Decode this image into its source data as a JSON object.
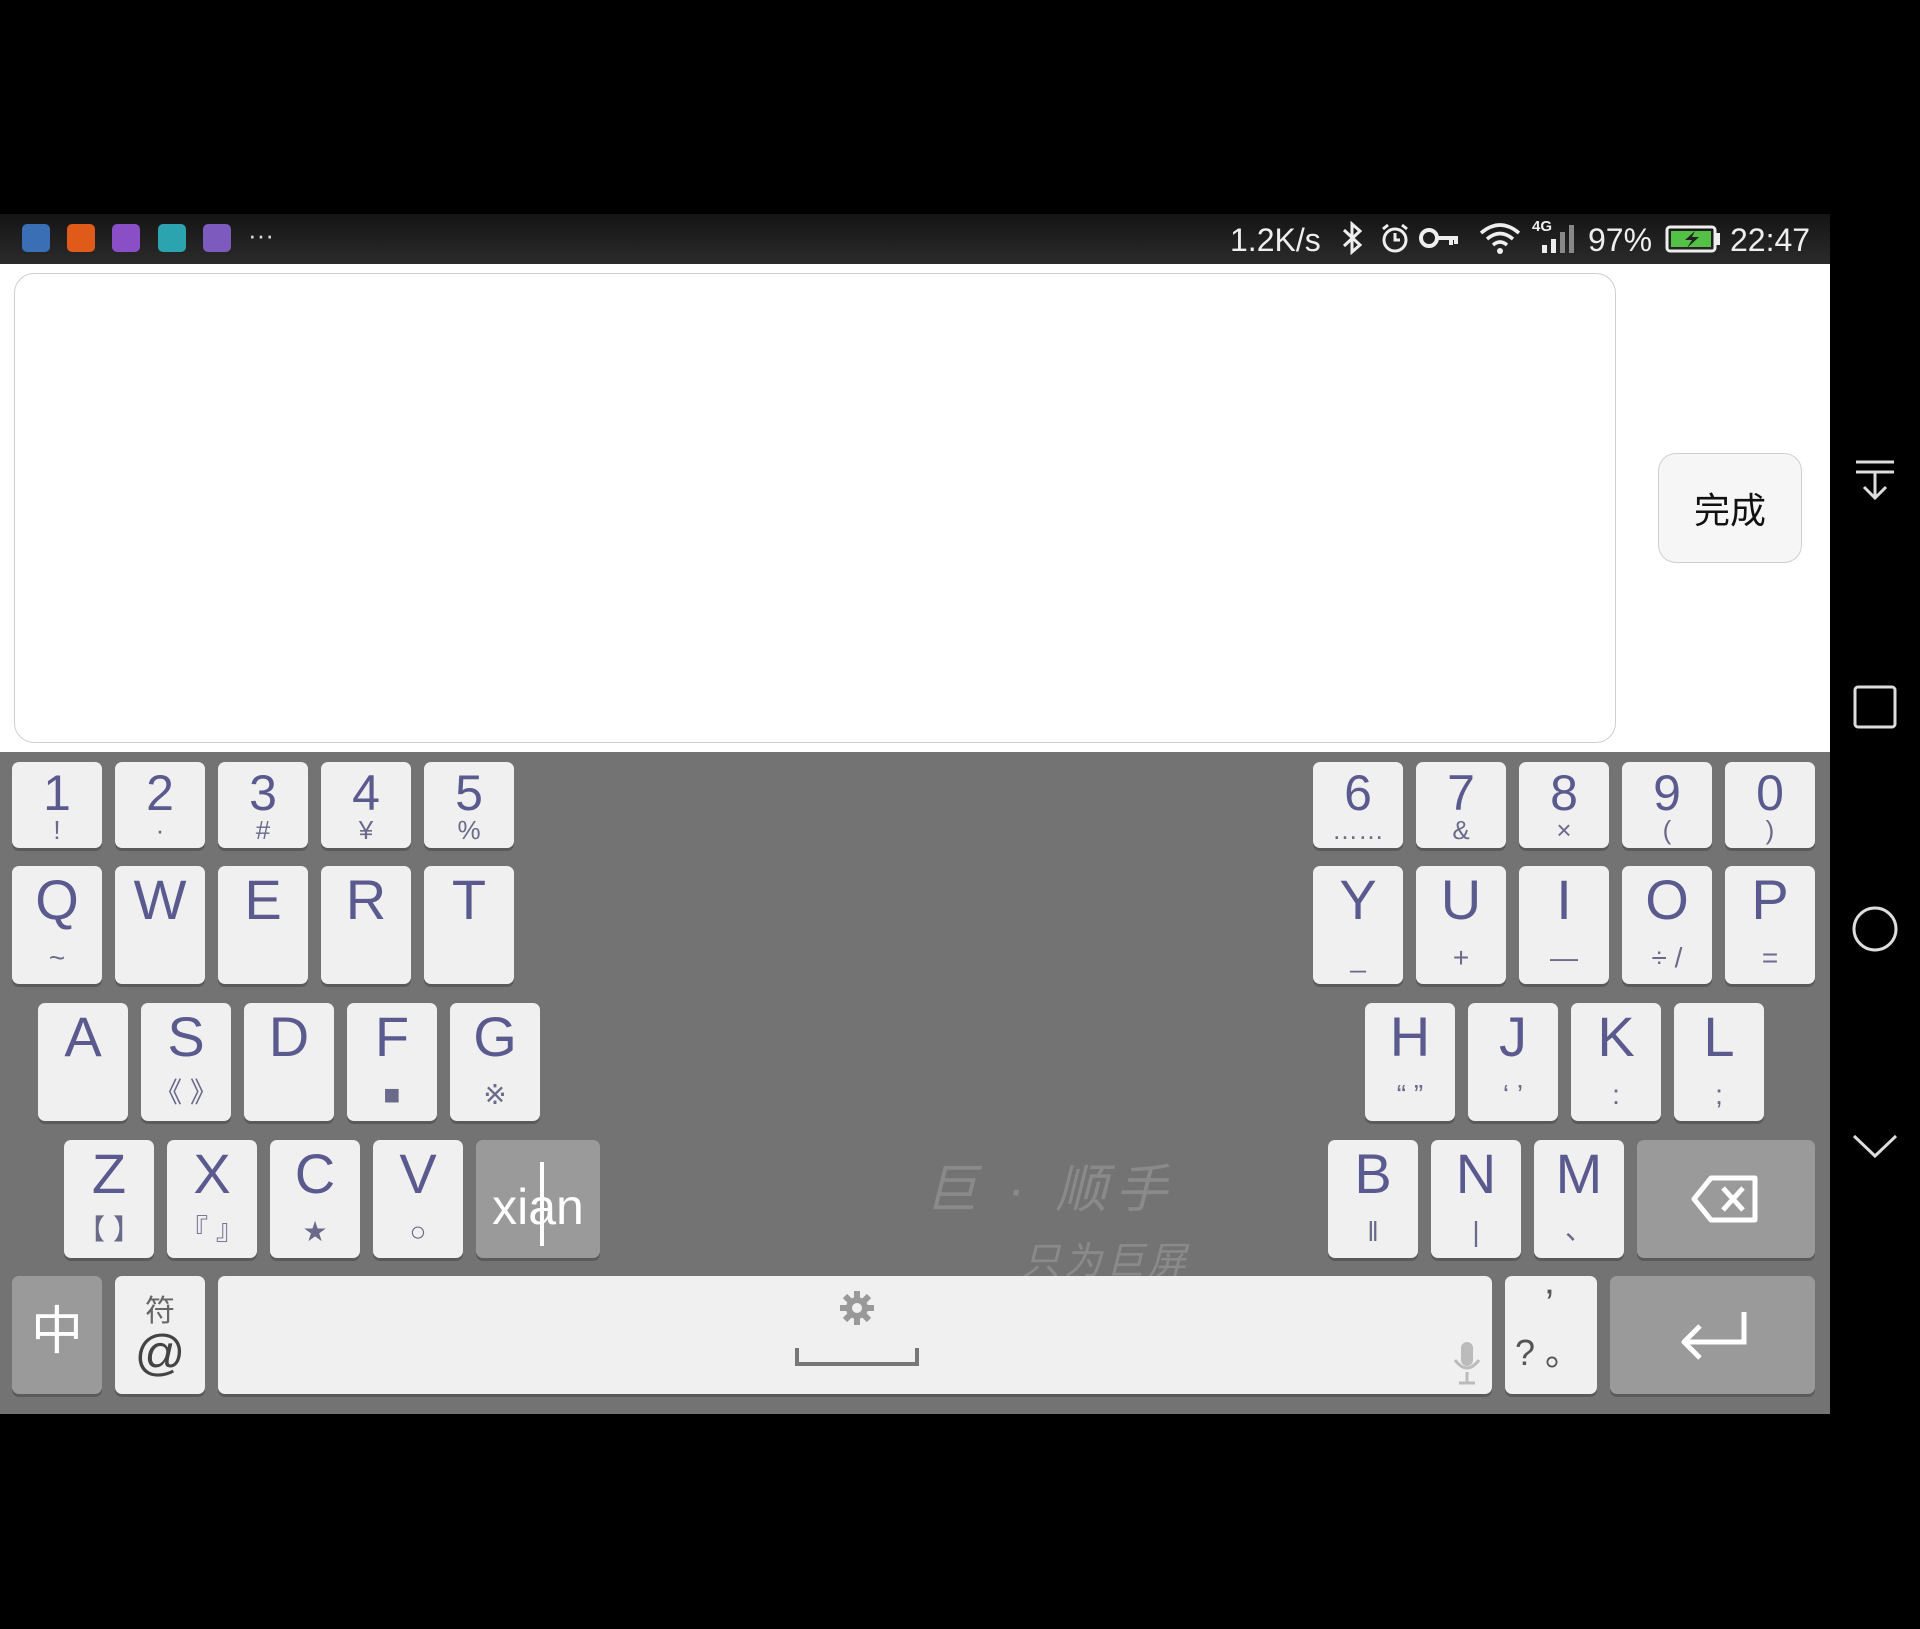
{
  "status_bar": {
    "more_label": "···",
    "net_speed": "1.2K/s",
    "network_type": "4G",
    "battery_pct": "97%",
    "time": "22:47",
    "app_icons": [
      "app-icon-1",
      "app-icon-mi",
      "app-icon-keyboard",
      "app-icon-android",
      "app-icon-mail"
    ],
    "icon_colors": [
      "#3a6fb5",
      "#e05a1a",
      "#8a4fc7",
      "#2ba4b0",
      "#7d5abd"
    ]
  },
  "editor": {
    "done_label": "完成"
  },
  "keyboard": {
    "number_keys_left": [
      {
        "main": "1",
        "sub": "!"
      },
      {
        "main": "2",
        "sub": "·"
      },
      {
        "main": "3",
        "sub": "#"
      },
      {
        "main": "4",
        "sub": "¥"
      },
      {
        "main": "5",
        "sub": "%"
      }
    ],
    "number_keys_right": [
      {
        "main": "6",
        "sub": "……"
      },
      {
        "main": "7",
        "sub": "&"
      },
      {
        "main": "8",
        "sub": "×"
      },
      {
        "main": "9",
        "sub": "("
      },
      {
        "main": "0",
        "sub": ")"
      }
    ],
    "row1_left": [
      {
        "main": "Q",
        "sub": "~"
      },
      {
        "main": "W",
        "sub": ""
      },
      {
        "main": "E",
        "sub": ""
      },
      {
        "main": "R",
        "sub": ""
      },
      {
        "main": "T",
        "sub": ""
      }
    ],
    "row1_right": [
      {
        "main": "Y",
        "sub": "_"
      },
      {
        "main": "U",
        "sub": "+"
      },
      {
        "main": "I",
        "sub": "—"
      },
      {
        "main": "O",
        "sub": "÷ /"
      },
      {
        "main": "P",
        "sub": "="
      }
    ],
    "row2_left": [
      {
        "main": "A",
        "sub": ""
      },
      {
        "main": "S",
        "sub": "《 》"
      },
      {
        "main": "D",
        "sub": ""
      },
      {
        "main": "F",
        "sub": "■"
      },
      {
        "main": "G",
        "sub": "※"
      }
    ],
    "row2_right": [
      {
        "main": "H",
        "sub": "“ ”"
      },
      {
        "main": "J",
        "sub": "‘ ’"
      },
      {
        "main": "K",
        "sub": ":"
      },
      {
        "main": "L",
        "sub": ";"
      }
    ],
    "row3_left": [
      {
        "main": "Z",
        "sub": "【 】"
      },
      {
        "main": "X",
        "sub": "『 』"
      },
      {
        "main": "C",
        "sub": "★"
      },
      {
        "main": "V",
        "sub": "○"
      }
    ],
    "row3_right": [
      {
        "main": "B",
        "sub": "‖"
      },
      {
        "main": "N",
        "sub": "|"
      },
      {
        "main": "M",
        "sub": "、"
      }
    ],
    "pinyin": "xian",
    "lang_label": "中",
    "symbol_top": "符",
    "symbol_main": "@",
    "punct_top": "’",
    "punct_bottom": "? 。",
    "watermark_title": "巨 · 顺手",
    "watermark_subtitle": "只为巨屏"
  }
}
